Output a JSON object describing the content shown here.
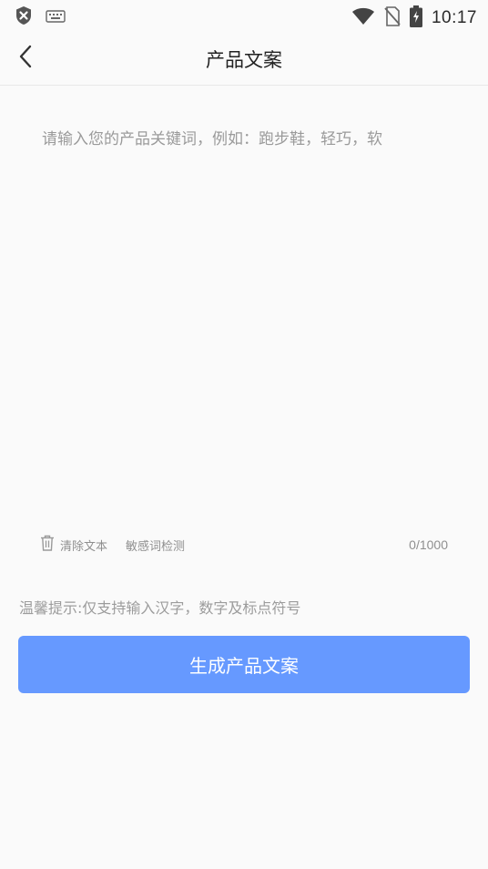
{
  "status_bar": {
    "time": "10:17",
    "icons": [
      "shield-x-icon",
      "keyboard-icon",
      "wifi-icon",
      "no-sim-icon",
      "battery-charging-icon"
    ]
  },
  "header": {
    "title": "产品文案",
    "back_icon": "chevron-left-icon"
  },
  "editor": {
    "placeholder": "请输入您的产品关键词，例如：跑步鞋，轻巧，软",
    "value": "",
    "clear_label": "清除文本",
    "sensitive_label": "敏感词检测",
    "count": "0/1000"
  },
  "tip": "温馨提示:仅支持输入汉字，数字及标点符号",
  "generate_label": "生成产品文案",
  "colors": {
    "accent": "#6699ff",
    "background": "#fafafa",
    "muted_text": "#9a9a9a"
  }
}
